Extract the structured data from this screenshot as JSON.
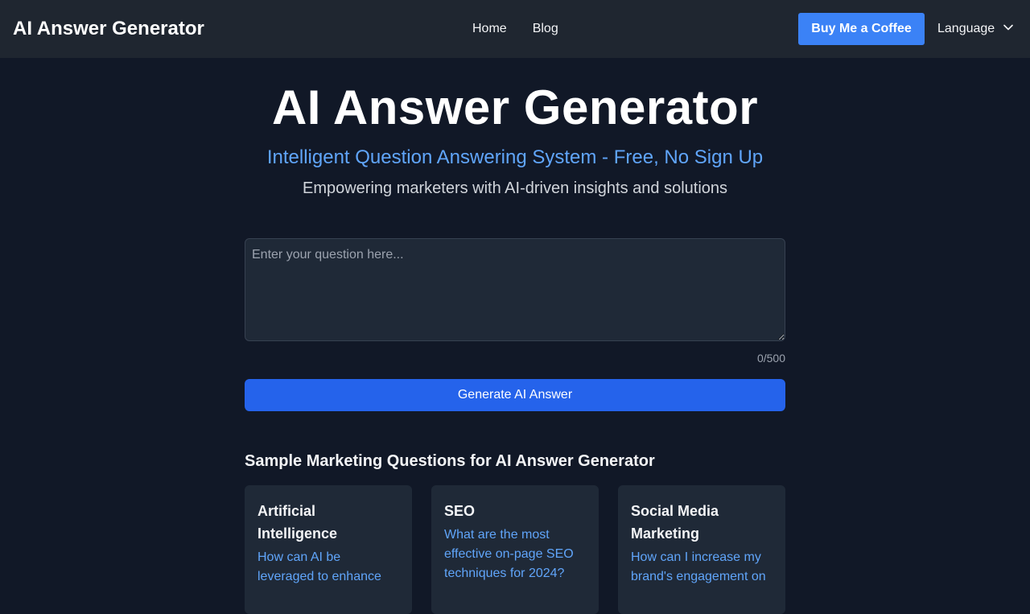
{
  "header": {
    "brand": "AI Answer Generator",
    "nav": {
      "home": "Home",
      "blog": "Blog"
    },
    "coffee_button": "Buy Me a Coffee",
    "language_label": "Language"
  },
  "hero": {
    "title": "AI Answer Generator",
    "subtitle": "Intelligent Question Answering System - Free, No Sign Up",
    "tagline": "Empowering marketers with AI-driven insights and solutions"
  },
  "form": {
    "placeholder": "Enter your question here...",
    "char_count": "0/500",
    "generate_button": "Generate AI Answer"
  },
  "samples": {
    "title": "Sample Marketing Questions for AI Answer Generator",
    "cards": [
      {
        "title": "Artificial Intelligence",
        "question": "How can AI be leveraged to enhance"
      },
      {
        "title": "SEO",
        "question": "What are the most effective on-page SEO techniques for 2024?"
      },
      {
        "title": "Social Media Marketing",
        "question": "How can I increase my brand's engagement on"
      }
    ]
  },
  "colors": {
    "background": "#111827",
    "navbar": "#1f2630",
    "accent": "#3b82f6",
    "primary_button": "#2563eb",
    "subtitle": "#60a5fa"
  },
  "icons": {
    "language_dropdown": "chevron-down-icon"
  }
}
